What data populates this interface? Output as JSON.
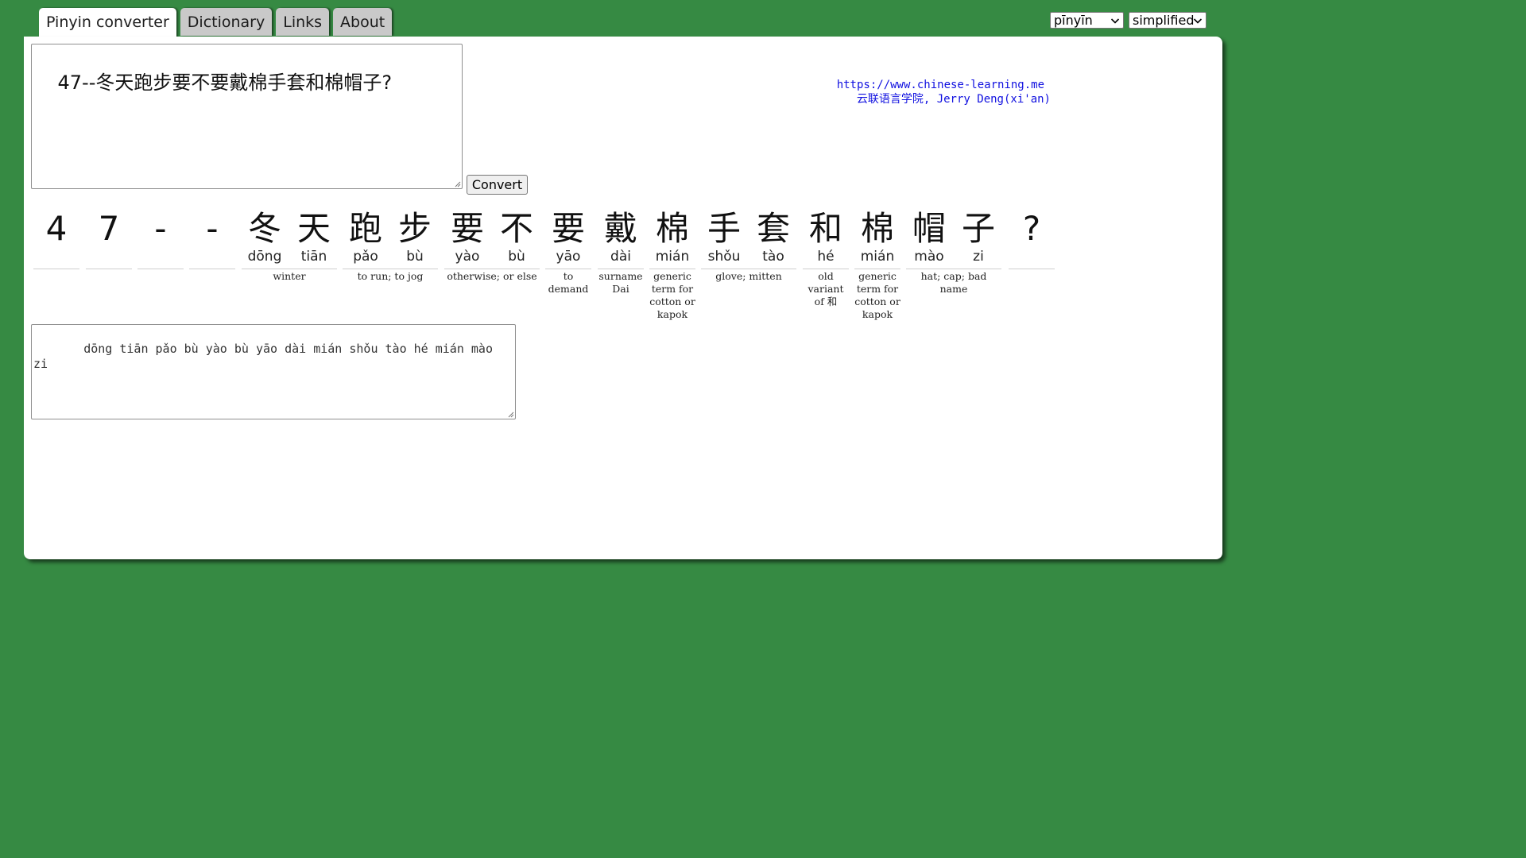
{
  "tabs": [
    {
      "label": "Pinyin converter"
    },
    {
      "label": "Dictionary"
    },
    {
      "label": "Links"
    },
    {
      "label": "About"
    }
  ],
  "selects": {
    "script": "pīnyīn",
    "charset": "simplified"
  },
  "input": {
    "value": "47--冬天跑步要不要戴棉手套和棉帽子?"
  },
  "convert_label": "Convert",
  "credit": {
    "url": "https://www.chinese-learning.me",
    "org": "云联语言学院, Jerry Deng(xi'an)"
  },
  "characters": [
    {
      "char": "4",
      "pinyin": ""
    },
    {
      "char": "7",
      "pinyin": ""
    },
    {
      "char": "-",
      "pinyin": ""
    },
    {
      "char": "-",
      "pinyin": ""
    },
    {
      "char": "冬",
      "pinyin": "dōng"
    },
    {
      "char": "天",
      "pinyin": "tiān"
    },
    {
      "char": "跑",
      "pinyin": "pǎo"
    },
    {
      "char": "步",
      "pinyin": "bù"
    },
    {
      "char": "要",
      "pinyin": "yào"
    },
    {
      "char": "不",
      "pinyin": "bù"
    },
    {
      "char": "要",
      "pinyin": "yāo"
    },
    {
      "char": "戴",
      "pinyin": "dài"
    },
    {
      "char": "棉",
      "pinyin": "mián"
    },
    {
      "char": "手",
      "pinyin": "shǒu"
    },
    {
      "char": "套",
      "pinyin": "tào"
    },
    {
      "char": "和",
      "pinyin": "hé"
    },
    {
      "char": "棉",
      "pinyin": "mián"
    },
    {
      "char": "帽",
      "pinyin": "mào"
    },
    {
      "char": "子",
      "pinyin": "zi"
    },
    {
      "char": "?",
      "pinyin": ""
    }
  ],
  "glosses": [
    {
      "text": "winter"
    },
    {
      "text": "to run; to jog"
    },
    {
      "text": "otherwise; or else"
    },
    {
      "text": "to demand"
    },
    {
      "text": "surname Dai"
    },
    {
      "text": "generic term for cotton or kapok"
    },
    {
      "text": "glove; mitten"
    },
    {
      "text": "old variant of 和"
    },
    {
      "text": "generic term for cotton or kapok"
    },
    {
      "text": "hat; cap; bad name"
    }
  ],
  "output": {
    "value": "   dōng tiān pǎo bù yào bù yāo dài mián shǒu tào hé mián mào zi"
  }
}
